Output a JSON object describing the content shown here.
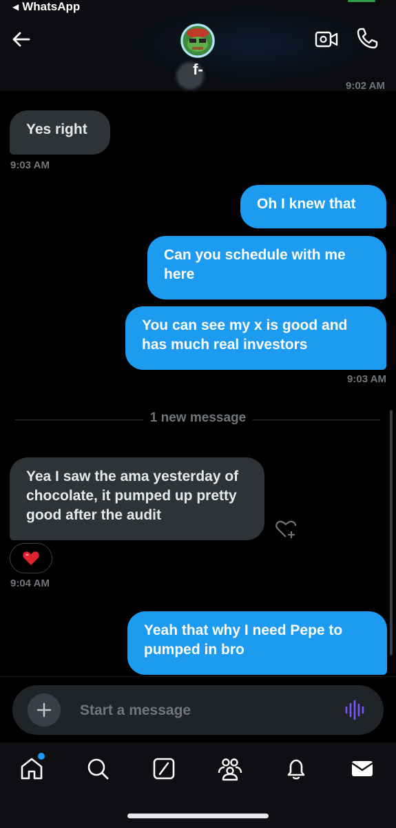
{
  "status": {
    "back_app": "WhatsApp"
  },
  "header": {
    "contact_name": "f-",
    "peek_time": "9:02 AM"
  },
  "messages": [
    {
      "direction": "received",
      "text": "Yes right"
    },
    {
      "time": "9:03 AM"
    },
    {
      "direction": "sent",
      "text": "Oh I knew that"
    },
    {
      "direction": "sent",
      "text": "Can you schedule with me here"
    },
    {
      "direction": "sent",
      "text": "You can see my x is good and has much real investors"
    },
    {
      "time": "9:03 AM"
    },
    {
      "divider": "1 new message"
    },
    {
      "direction": "received",
      "text": "Yea I saw the ama yesterday of chocolate, it pumped up pretty good after the audit"
    },
    {
      "reaction": "heart"
    },
    {
      "time": "9:04 AM"
    },
    {
      "direction": "sent",
      "text": "Yeah that why I need Pepe to pumped in bro"
    }
  ],
  "composer": {
    "placeholder": "Start a message"
  },
  "nav": [
    "home-icon",
    "search-icon",
    "grok-icon",
    "communities-icon",
    "notifications-icon",
    "messages-icon"
  ],
  "colors": {
    "accent": "#1d9bf0",
    "received_bubble": "#2f3336",
    "background": "#000000",
    "voice_accent": "#7856ff"
  }
}
